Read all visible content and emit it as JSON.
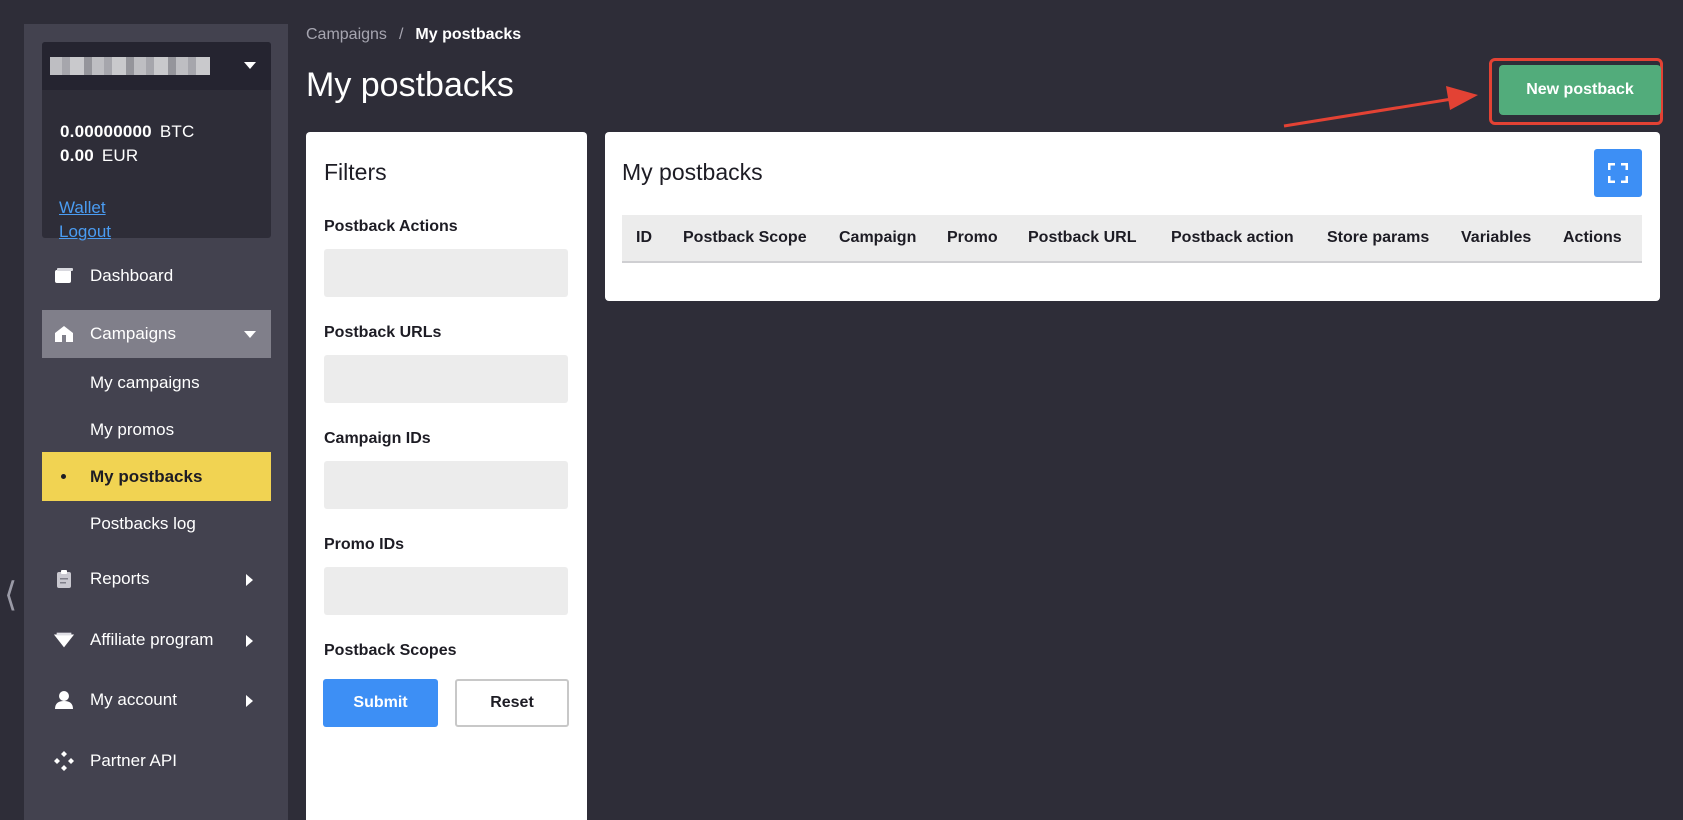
{
  "account": {
    "btc_amount": "0.00000000",
    "btc_currency": "BTC",
    "eur_amount": "0.00",
    "eur_currency": "EUR",
    "wallet_link": "Wallet",
    "logout_link": "Logout"
  },
  "sidebar": {
    "dashboard": "Dashboard",
    "campaigns": "Campaigns",
    "my_campaigns": "My campaigns",
    "my_promos": "My promos",
    "my_postbacks": "My postbacks",
    "postbacks_log": "Postbacks log",
    "reports": "Reports",
    "affiliate_program": "Affiliate program",
    "my_account": "My account",
    "partner_api": "Partner API"
  },
  "breadcrumb": {
    "parent": "Campaigns",
    "separator": "/",
    "current": "My postbacks"
  },
  "page_title": "My postbacks",
  "new_button": "New postback",
  "filters": {
    "title": "Filters",
    "postback_actions": "Postback Actions",
    "postback_urls": "Postback URLs",
    "campaign_ids": "Campaign IDs",
    "promo_ids": "Promo IDs",
    "postback_scopes": "Postback Scopes",
    "submit": "Submit",
    "reset": "Reset"
  },
  "table": {
    "title": "My postbacks",
    "columns": [
      "ID",
      "Postback Scope",
      "Campaign",
      "Promo",
      "Postback URL",
      "Postback action",
      "Store params",
      "Variables",
      "Actions"
    ]
  },
  "colors": {
    "background": "#2e2d38",
    "sidebar": "#43424f",
    "active_item": "#f1d352",
    "primary_blue": "#3d8ff5",
    "new_button_green": "#52ac7b",
    "annotation_red": "#e34234"
  }
}
